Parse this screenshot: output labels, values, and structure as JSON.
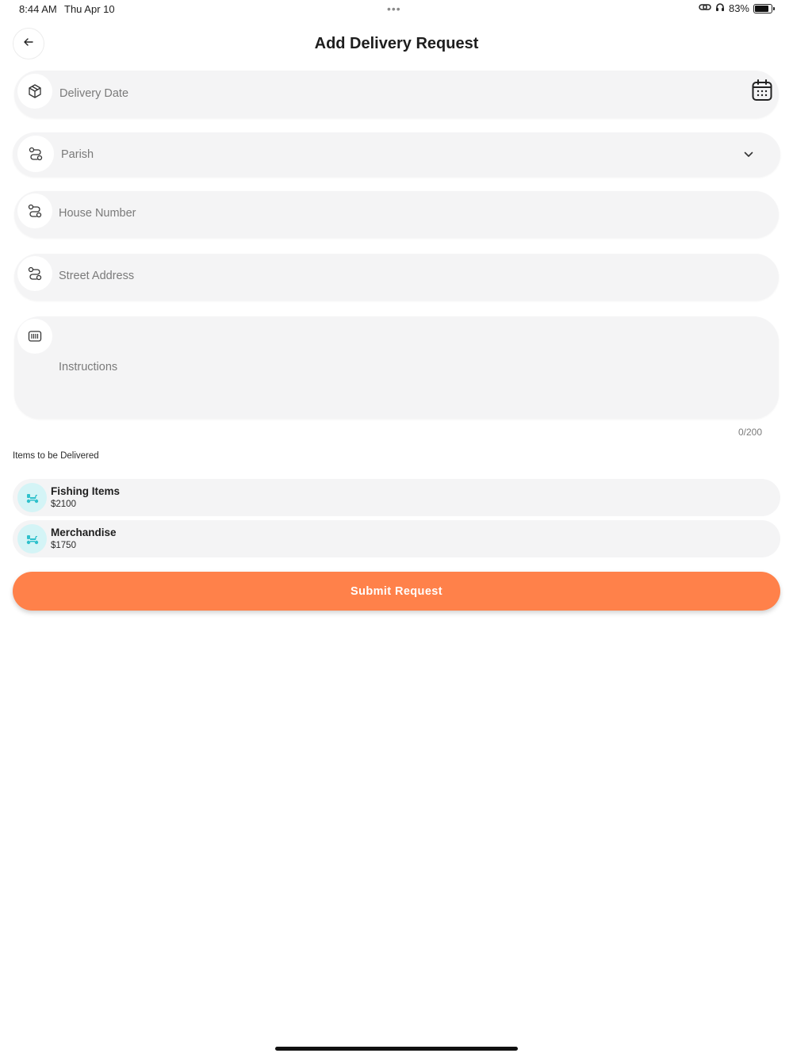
{
  "status_bar": {
    "time": "8:44 AM",
    "date": "Thu Apr 10",
    "dots": "•••",
    "battery_text": "83%",
    "battery_level": 0.83
  },
  "header": {
    "title": "Add Delivery Request",
    "back_icon": "arrow-left-icon"
  },
  "form": {
    "delivery_date": {
      "placeholder": "Delivery Date",
      "icon": "box-icon",
      "trailing_icon": "calendar-icon"
    },
    "parish": {
      "placeholder": "Parish",
      "icon": "route-icon",
      "trailing_icon": "chevron-down-icon"
    },
    "house_number": {
      "placeholder": "House Number",
      "icon": "route-icon"
    },
    "street_address": {
      "placeholder": "Street Address",
      "icon": "route-icon"
    },
    "instructions": {
      "placeholder": "Instructions",
      "icon": "barcode-icon",
      "counter": "0/200"
    }
  },
  "items_section": {
    "label": "Items to be Delivered",
    "items": [
      {
        "name": "Fishing Items",
        "price": "$2100",
        "icon": "scooter-icon"
      },
      {
        "name": "Merchandise",
        "price": "$1750",
        "icon": "scooter-icon"
      }
    ]
  },
  "submit": {
    "label": "Submit Request"
  },
  "colors": {
    "accent": "#ff814a",
    "field_bg": "#f4f4f5",
    "item_icon_bg": "#d4f4f6",
    "item_icon": "#2fc1cc"
  }
}
